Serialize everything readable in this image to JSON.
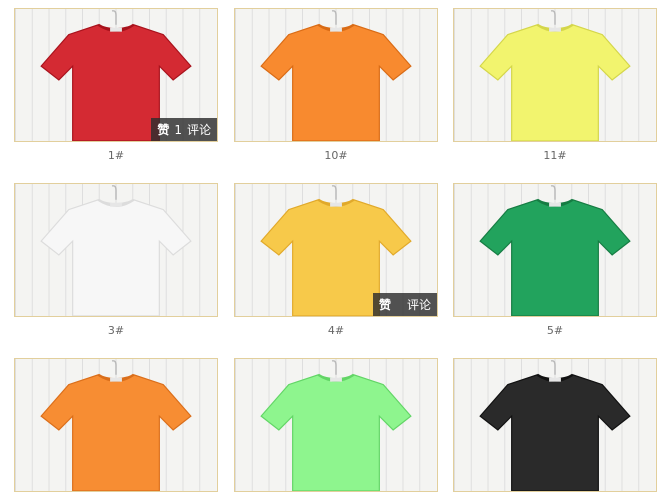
{
  "items": [
    {
      "label": "1#",
      "color": "#d42a33",
      "shade": "#a8121c",
      "overlay": {
        "like": "赞",
        "count": "1",
        "comment": "评论"
      }
    },
    {
      "label": "10#",
      "color": "#f88a2f",
      "shade": "#d96b15",
      "overlay": null
    },
    {
      "label": "11#",
      "color": "#f2f46e",
      "shade": "#d4d64a",
      "overlay": null
    },
    {
      "label": "3#",
      "color": "#f7f7f7",
      "shade": "#dcdcdc",
      "overlay": null
    },
    {
      "label": "4#",
      "color": "#f7c94a",
      "shade": "#e1a92a",
      "overlay": {
        "like": "赞",
        "count": "",
        "comment": "评论"
      }
    },
    {
      "label": "5#",
      "color": "#22a35d",
      "shade": "#167c43",
      "overlay": null
    },
    {
      "label": "",
      "color": "#f78d33",
      "shade": "#da6e1a",
      "overlay": null
    },
    {
      "label": "",
      "color": "#8ef58e",
      "shade": "#62d566",
      "overlay": null
    },
    {
      "label": "",
      "color": "#2a2a2a",
      "shade": "#111111",
      "overlay": null
    }
  ]
}
